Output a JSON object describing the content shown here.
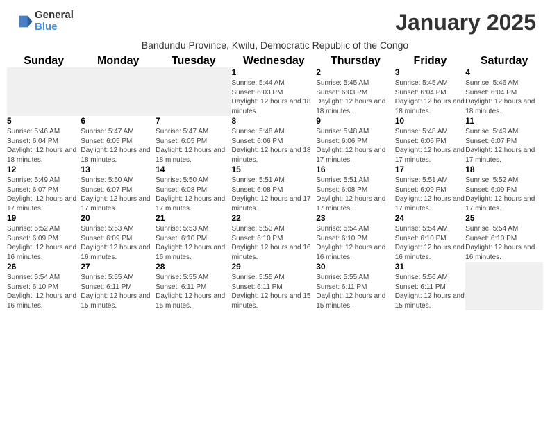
{
  "header": {
    "logo_general": "General",
    "logo_blue": "Blue",
    "month_title": "January 2025",
    "subtitle": "Bandundu Province, Kwilu, Democratic Republic of the Congo"
  },
  "weekdays": [
    "Sunday",
    "Monday",
    "Tuesday",
    "Wednesday",
    "Thursday",
    "Friday",
    "Saturday"
  ],
  "weeks": [
    [
      {
        "day": "",
        "info": ""
      },
      {
        "day": "",
        "info": ""
      },
      {
        "day": "",
        "info": ""
      },
      {
        "day": "1",
        "info": "Sunrise: 5:44 AM\nSunset: 6:03 PM\nDaylight: 12 hours and 18 minutes."
      },
      {
        "day": "2",
        "info": "Sunrise: 5:45 AM\nSunset: 6:03 PM\nDaylight: 12 hours and 18 minutes."
      },
      {
        "day": "3",
        "info": "Sunrise: 5:45 AM\nSunset: 6:04 PM\nDaylight: 12 hours and 18 minutes."
      },
      {
        "day": "4",
        "info": "Sunrise: 5:46 AM\nSunset: 6:04 PM\nDaylight: 12 hours and 18 minutes."
      }
    ],
    [
      {
        "day": "5",
        "info": "Sunrise: 5:46 AM\nSunset: 6:04 PM\nDaylight: 12 hours and 18 minutes."
      },
      {
        "day": "6",
        "info": "Sunrise: 5:47 AM\nSunset: 6:05 PM\nDaylight: 12 hours and 18 minutes."
      },
      {
        "day": "7",
        "info": "Sunrise: 5:47 AM\nSunset: 6:05 PM\nDaylight: 12 hours and 18 minutes."
      },
      {
        "day": "8",
        "info": "Sunrise: 5:48 AM\nSunset: 6:06 PM\nDaylight: 12 hours and 18 minutes."
      },
      {
        "day": "9",
        "info": "Sunrise: 5:48 AM\nSunset: 6:06 PM\nDaylight: 12 hours and 17 minutes."
      },
      {
        "day": "10",
        "info": "Sunrise: 5:48 AM\nSunset: 6:06 PM\nDaylight: 12 hours and 17 minutes."
      },
      {
        "day": "11",
        "info": "Sunrise: 5:49 AM\nSunset: 6:07 PM\nDaylight: 12 hours and 17 minutes."
      }
    ],
    [
      {
        "day": "12",
        "info": "Sunrise: 5:49 AM\nSunset: 6:07 PM\nDaylight: 12 hours and 17 minutes."
      },
      {
        "day": "13",
        "info": "Sunrise: 5:50 AM\nSunset: 6:07 PM\nDaylight: 12 hours and 17 minutes."
      },
      {
        "day": "14",
        "info": "Sunrise: 5:50 AM\nSunset: 6:08 PM\nDaylight: 12 hours and 17 minutes."
      },
      {
        "day": "15",
        "info": "Sunrise: 5:51 AM\nSunset: 6:08 PM\nDaylight: 12 hours and 17 minutes."
      },
      {
        "day": "16",
        "info": "Sunrise: 5:51 AM\nSunset: 6:08 PM\nDaylight: 12 hours and 17 minutes."
      },
      {
        "day": "17",
        "info": "Sunrise: 5:51 AM\nSunset: 6:09 PM\nDaylight: 12 hours and 17 minutes."
      },
      {
        "day": "18",
        "info": "Sunrise: 5:52 AM\nSunset: 6:09 PM\nDaylight: 12 hours and 17 minutes."
      }
    ],
    [
      {
        "day": "19",
        "info": "Sunrise: 5:52 AM\nSunset: 6:09 PM\nDaylight: 12 hours and 16 minutes."
      },
      {
        "day": "20",
        "info": "Sunrise: 5:53 AM\nSunset: 6:09 PM\nDaylight: 12 hours and 16 minutes."
      },
      {
        "day": "21",
        "info": "Sunrise: 5:53 AM\nSunset: 6:10 PM\nDaylight: 12 hours and 16 minutes."
      },
      {
        "day": "22",
        "info": "Sunrise: 5:53 AM\nSunset: 6:10 PM\nDaylight: 12 hours and 16 minutes."
      },
      {
        "day": "23",
        "info": "Sunrise: 5:54 AM\nSunset: 6:10 PM\nDaylight: 12 hours and 16 minutes."
      },
      {
        "day": "24",
        "info": "Sunrise: 5:54 AM\nSunset: 6:10 PM\nDaylight: 12 hours and 16 minutes."
      },
      {
        "day": "25",
        "info": "Sunrise: 5:54 AM\nSunset: 6:10 PM\nDaylight: 12 hours and 16 minutes."
      }
    ],
    [
      {
        "day": "26",
        "info": "Sunrise: 5:54 AM\nSunset: 6:10 PM\nDaylight: 12 hours and 16 minutes."
      },
      {
        "day": "27",
        "info": "Sunrise: 5:55 AM\nSunset: 6:11 PM\nDaylight: 12 hours and 15 minutes."
      },
      {
        "day": "28",
        "info": "Sunrise: 5:55 AM\nSunset: 6:11 PM\nDaylight: 12 hours and 15 minutes."
      },
      {
        "day": "29",
        "info": "Sunrise: 5:55 AM\nSunset: 6:11 PM\nDaylight: 12 hours and 15 minutes."
      },
      {
        "day": "30",
        "info": "Sunrise: 5:55 AM\nSunset: 6:11 PM\nDaylight: 12 hours and 15 minutes."
      },
      {
        "day": "31",
        "info": "Sunrise: 5:56 AM\nSunset: 6:11 PM\nDaylight: 12 hours and 15 minutes."
      },
      {
        "day": "",
        "info": ""
      }
    ]
  ]
}
